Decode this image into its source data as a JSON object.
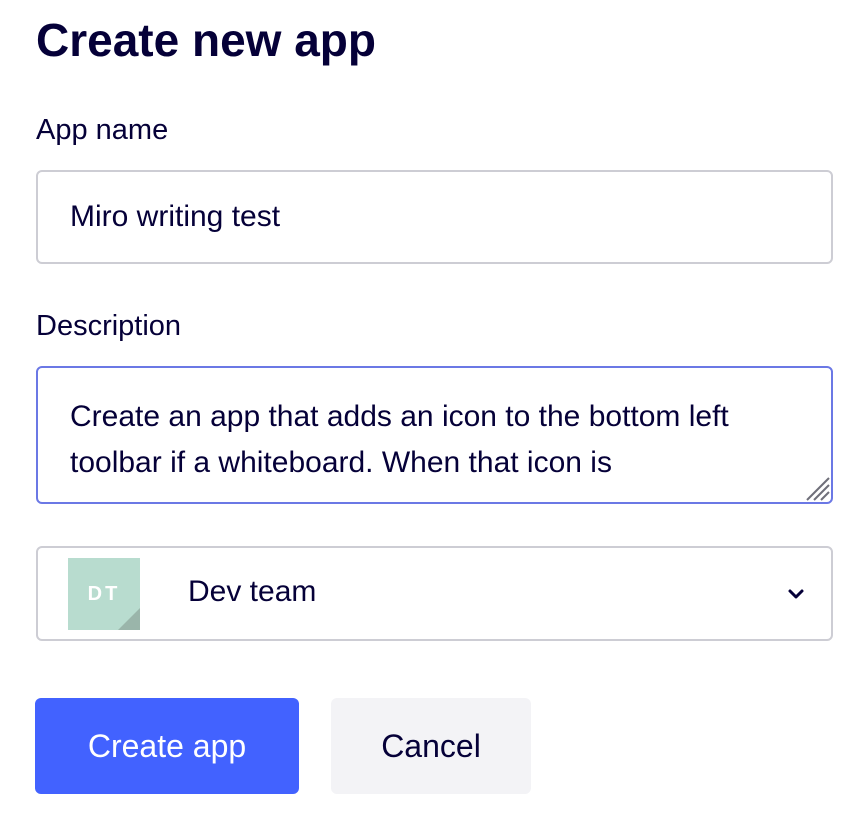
{
  "page": {
    "title": "Create new app"
  },
  "form": {
    "app_name": {
      "label": "App name",
      "value": "Miro writing test"
    },
    "description": {
      "label": "Description",
      "value": "Create an app that adds an icon to the bottom left toolbar if a whiteboard. When that icon is"
    },
    "team": {
      "avatar_initials": "DT",
      "avatar_color": "#b8dccf",
      "selected": "Dev team"
    }
  },
  "actions": {
    "create_label": "Create app",
    "cancel_label": "Cancel"
  },
  "colors": {
    "primary": "#4262ff",
    "text": "#050038",
    "focus_border": "#6b78e5"
  },
  "icons": {
    "select": "chevron-down-icon",
    "textarea": "resize-handle-icon"
  }
}
